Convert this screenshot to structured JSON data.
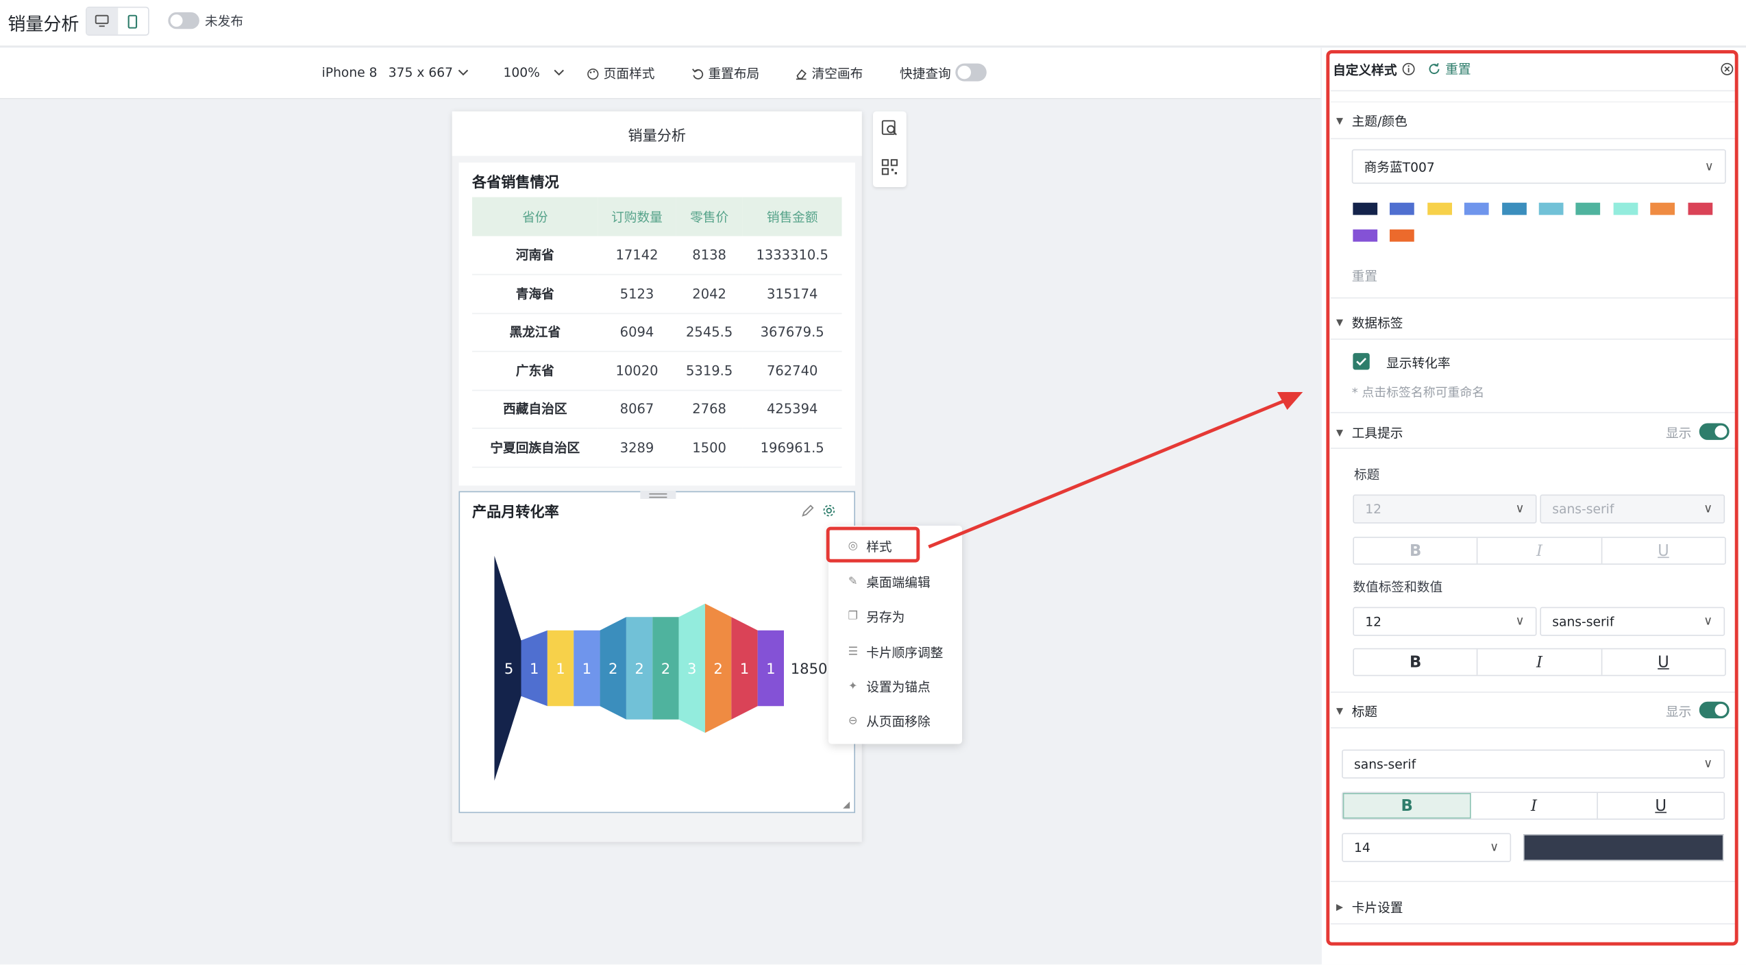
{
  "app": {
    "title": "销量分析",
    "publish_status": "未发布"
  },
  "toolbar": {
    "device": "iPhone 8",
    "resolution": "375 x 667",
    "zoom": "100%",
    "page_style": "页面样式",
    "reset_layout": "重置布局",
    "clear_canvas": "清空画布",
    "quick_query": "快捷查询"
  },
  "phone": {
    "header_title": "销量分析",
    "table_card": {
      "title": "各省销售情况",
      "columns": [
        "省份",
        "订购数量",
        "零售价",
        "销售金额"
      ],
      "rows": [
        [
          "河南省",
          "17142",
          "8138",
          "1333310.5"
        ],
        [
          "青海省",
          "5123",
          "2042",
          "315174"
        ],
        [
          "黑龙江省",
          "6094",
          "2545.5",
          "367679.5"
        ],
        [
          "广东省",
          "10020",
          "5319.5",
          "762740"
        ],
        [
          "西藏自治区",
          "8067",
          "2768",
          "425394"
        ],
        [
          "宁夏回族自治区",
          "3289",
          "1500",
          "196961.5"
        ]
      ]
    },
    "funnel_card": {
      "title": "产品月转化率",
      "segment_labels": [
        "5",
        "1",
        "1",
        "1",
        "2",
        "2",
        "2",
        "3",
        "2",
        "1",
        "1",
        "1850"
      ]
    }
  },
  "chart_data": {
    "type": "funnel",
    "title": "产品月转化率",
    "series": [
      {
        "values": [
          5,
          1,
          1,
          1,
          2,
          2,
          2,
          3,
          2,
          1,
          1
        ]
      }
    ],
    "colors": [
      "#14234b",
      "#4f6fd0",
      "#f7d14a",
      "#6f95ec",
      "#3b8ebd",
      "#71c1d7",
      "#4fb39e",
      "#93ecdd",
      "#ef8b42",
      "#da4357",
      "#8452d6"
    ],
    "trailing_label": "1850"
  },
  "context_menu": {
    "items": [
      "样式",
      "桌面端编辑",
      "另存为",
      "卡片顺序调整",
      "设置为锚点",
      "从页面移除"
    ]
  },
  "panel": {
    "title": "自定义样式",
    "reset": "重置",
    "theme": {
      "section_title": "主题/颜色",
      "selected": "商务蓝T007",
      "swatches": [
        "#14234b",
        "#4f6fd0",
        "#f7d14a",
        "#6f95ec",
        "#3b8ebd",
        "#71c1d7",
        "#4fb39e",
        "#93ecdd",
        "#ef8b42",
        "#da4357",
        "#8452d6",
        "#ec6a2c"
      ],
      "reset_label": "重置"
    },
    "data_label": {
      "section_title": "数据标签",
      "checkbox_label": "显示转化率",
      "hint": "* 点击标签名称可重命名"
    },
    "tooltip": {
      "section_title": "工具提示",
      "show_label": "显示",
      "title_label": "标题",
      "title_size": "12",
      "title_font": "sans-serif",
      "value_label": "数值标签和数值",
      "value_size": "12",
      "value_font": "sans-serif"
    },
    "title_section": {
      "section_title": "标题",
      "show_label": "显示",
      "font": "sans-serif",
      "size": "14",
      "color": "#343c4e"
    },
    "card_settings": {
      "section_title": "卡片设置"
    },
    "format_buttons": {
      "bold": "B",
      "italic": "I",
      "underline": "U"
    }
  },
  "colors": {
    "accent": "#2e7d6b",
    "highlight": "#e53935",
    "table_header_bg": "#e5f1e8",
    "table_header_text": "#56a38a"
  }
}
